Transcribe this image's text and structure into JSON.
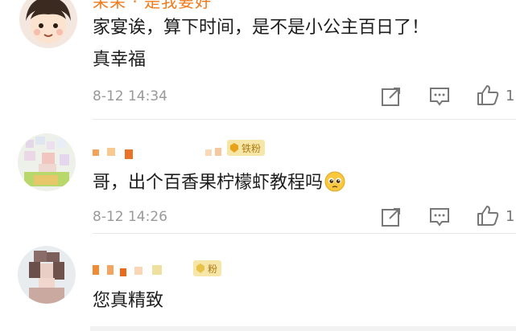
{
  "comments": [
    {
      "username": "呆呆 · 是我要好",
      "text_line1": "家宴诶，算下时间，是不是小公主百日了！",
      "text_line2": "真幸福",
      "time": "8-12 14:34",
      "like_count": "1",
      "avatar_icon": "cartoon-boy-avatar"
    },
    {
      "username": "",
      "badge": "铁粉",
      "text": "哥，出个百香果柠檬虾教程吗",
      "emoji": "pleading-face-emoji",
      "time": "8-12 14:26",
      "like_count": "1",
      "avatar_icon": "blurred-avatar"
    },
    {
      "username": "",
      "badge": "粉",
      "text": "您真精致",
      "avatar_icon": "blurred-avatar"
    }
  ],
  "colors": {
    "username": "#f07a1b",
    "meta": "#999999",
    "badge_bg": "#f6e6a8",
    "badge_text": "#b07a10"
  }
}
